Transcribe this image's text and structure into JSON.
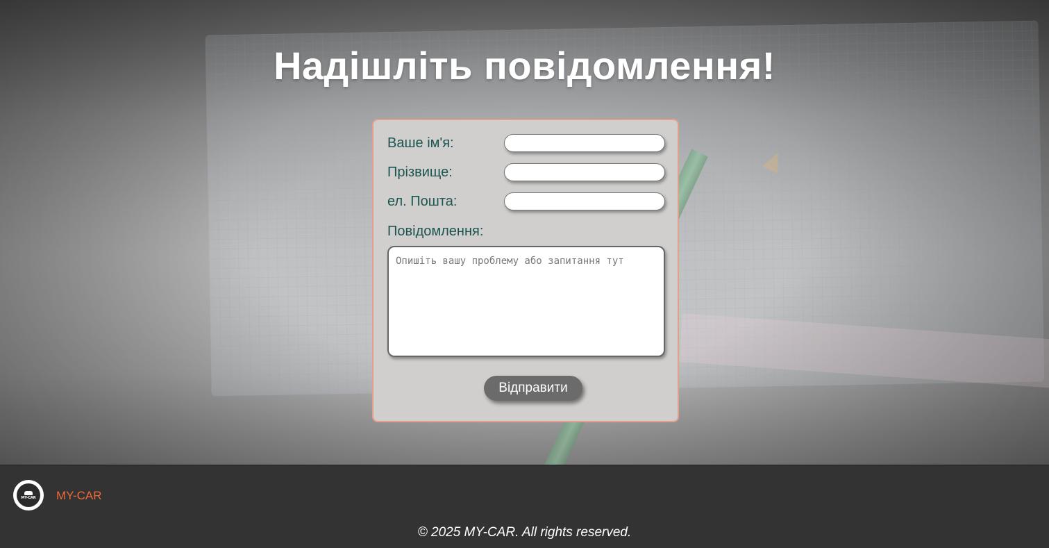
{
  "page": {
    "title": "Надішліть повідомлення!"
  },
  "form": {
    "first_name_label": "Ваше ім'я:",
    "first_name_value": "",
    "last_name_label": "Прізвище:",
    "last_name_value": "",
    "email_label": "ел. Пошта:",
    "email_value": "",
    "message_label": "Повідомлення:",
    "message_placeholder": "Опишіть вашу проблему або запитання тут",
    "submit_label": "Відправити"
  },
  "footer": {
    "logo_text": "MY-CAR",
    "brand": "MY-CAR",
    "copyright": "© 2025 MY-CAR. All rights reserved."
  },
  "colors": {
    "label_text": "#1b5450",
    "brand_accent": "#ee6a3a",
    "card_background": "#d0cfcd",
    "card_border": "#e0a08a",
    "button_background": "#6b6b6b",
    "footer_background": "#333333"
  }
}
